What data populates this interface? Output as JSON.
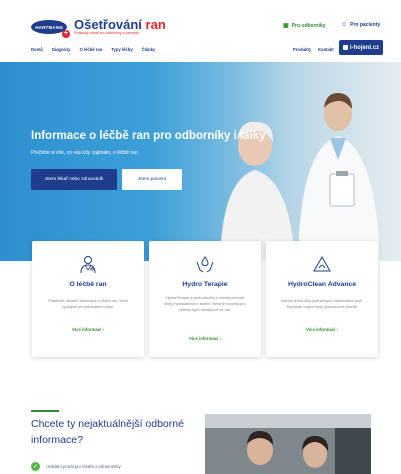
{
  "header": {
    "logo_text": "HARTMANN",
    "brand_title_part1": "Ošetřování",
    "brand_title_part2": "ran",
    "brand_subtitle": "Praktický portál pro odborníky a pacienty",
    "audience_pro": "Pro odborníky",
    "audience_patients": "Pro pacienty",
    "nav": [
      "Domů",
      "Diagnózy",
      "O léčbě ran",
      "Typy léčby",
      "Články"
    ],
    "nav_products": "Produkty",
    "nav_contact": "Kontakt",
    "hojeni_label": "i-hojeni.cz"
  },
  "hero": {
    "title": "Informace o léčbě ran pro odborníky i laiky",
    "subtitle": "Přečtěte si vše, co vás kdy zajímalo, o léčbě ran",
    "btn_pro": "Jsem lékař nebo zdravotník",
    "btn_patient": "Jsem pacient"
  },
  "cards": [
    {
      "title": "O léčbě ran",
      "text": "Praktické, detailní informace o léčbě ran, které využijete při každodenní praxi.",
      "link": "Více informací ›"
    },
    {
      "title": "Hydro Terapie",
      "text": "HydroTerapie je jednoduchá a účinná metoda léčby hydroaktivním krytím, která je vhodná pro většinu typů nehojících se ran.",
      "link": "Více informací ›"
    },
    {
      "title": "HydroClean Advance",
      "text": "Účinná léčba díky jedinečným vlastnostem krytí. Rychlejší hojení rány, jednoduché použití",
      "link": "Více informací ›"
    }
  ],
  "bottom": {
    "title": "Chcete ty nejaktuálnější odborné informace?",
    "item1": "Unikátní portál pro lékaře a zdravotníky"
  },
  "colors": {
    "brand_blue": "#1f3d8c",
    "brand_red": "#e3222d",
    "accent_green": "#2e8b2e"
  }
}
